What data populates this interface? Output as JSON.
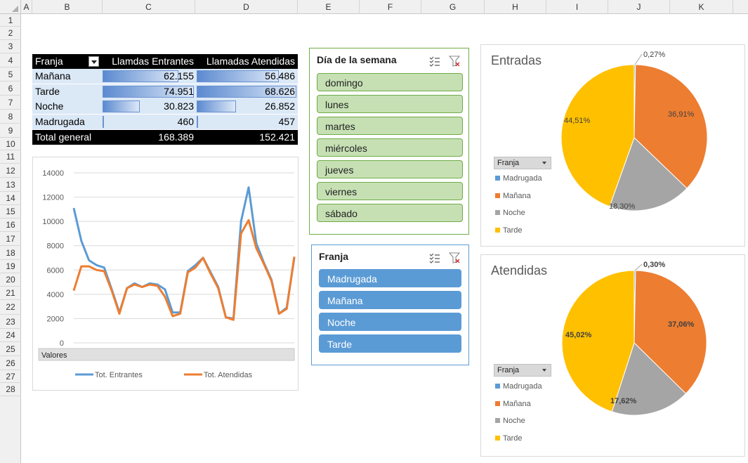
{
  "columns": [
    "A",
    "B",
    "C",
    "D",
    "E",
    "F",
    "G",
    "H",
    "I",
    "J",
    "K"
  ],
  "rows": [
    "1",
    "2",
    "3",
    "4",
    "5",
    "6",
    "7",
    "8",
    "9",
    "10",
    "11",
    "12",
    "13",
    "14",
    "15",
    "16",
    "17",
    "18",
    "19",
    "20",
    "21",
    "22",
    "23",
    "24",
    "25",
    "26",
    "27",
    "28"
  ],
  "pivot": {
    "headers": [
      "Franja",
      "Llamdas Entrantes",
      "Llamadas Atendidas"
    ],
    "rows": [
      {
        "label": "Mañana",
        "entrantes": "62.155",
        "atendidas": "56.486",
        "e": 62155,
        "a": 56486
      },
      {
        "label": "Tarde",
        "entrantes": "74.951",
        "atendidas": "68.626",
        "e": 74951,
        "a": 68626
      },
      {
        "label": "Noche",
        "entrantes": "30.823",
        "atendidas": "26.852",
        "e": 30823,
        "a": 26852
      },
      {
        "label": "Madrugada",
        "entrantes": "460",
        "atendidas": "457",
        "e": 460,
        "a": 457
      }
    ],
    "total": {
      "label": "Total general",
      "entrantes": "168.389",
      "atendidas": "152.421"
    }
  },
  "slicer_day": {
    "title": "Día de la semana",
    "items": [
      "domingo",
      "lunes",
      "martes",
      "miércoles",
      "jueves",
      "viernes",
      "sábado"
    ]
  },
  "slicer_franja": {
    "title": "Franja",
    "items": [
      "Madrugada",
      "Mañana",
      "Noche",
      "Tarde"
    ]
  },
  "colors": {
    "blue": "#5b9bd5",
    "orange": "#ed7d31",
    "gray": "#a5a5a5",
    "yellow": "#ffc000",
    "green_item": "#c6e0b4",
    "blue_item": "#5b9bd5"
  },
  "chart_data": [
    {
      "type": "line",
      "ylim": [
        0,
        14000
      ],
      "yticks": [
        "0",
        "2000",
        "4000",
        "6000",
        "8000",
        "10000",
        "12000",
        "14000"
      ],
      "field_button": "Valores",
      "series": [
        {
          "name": "Tot. Entrantes",
          "color": "#5b9bd5",
          "values": [
            11100,
            8400,
            6800,
            6400,
            6200,
            4400,
            2500,
            4500,
            4900,
            4600,
            4900,
            4800,
            4400,
            2500,
            2500,
            5900,
            6400,
            7000,
            5800,
            4600,
            2100,
            2000,
            10000,
            12800,
            8200,
            6600,
            5200,
            2400,
            2900,
            7000
          ]
        },
        {
          "name": "Tot. Atendidas",
          "color": "#ed7d31",
          "values": [
            4300,
            6300,
            6300,
            6000,
            5900,
            4300,
            2400,
            4500,
            4800,
            4600,
            4800,
            4700,
            3800,
            2200,
            2400,
            5800,
            6200,
            7000,
            5700,
            4500,
            2100,
            1900,
            9000,
            10100,
            7800,
            6500,
            5100,
            2400,
            2800,
            7100
          ]
        }
      ]
    },
    {
      "type": "pie",
      "title": "Entradas",
      "legend_title": "Franja",
      "categories": [
        "Madrugada",
        "Mañana",
        "Noche",
        "Tarde"
      ],
      "values": [
        0.27,
        36.91,
        18.3,
        44.51
      ],
      "labels": [
        "0,27%",
        "36,91%",
        "18,30%",
        "44,51%"
      ]
    },
    {
      "type": "pie",
      "title": "Atendidas",
      "legend_title": "Franja",
      "categories": [
        "Madrugada",
        "Mañana",
        "Noche",
        "Tarde"
      ],
      "values": [
        0.3,
        37.06,
        17.62,
        45.02
      ],
      "labels": [
        "0,30%",
        "37,06%",
        "17,62%",
        "45,02%"
      ]
    }
  ]
}
